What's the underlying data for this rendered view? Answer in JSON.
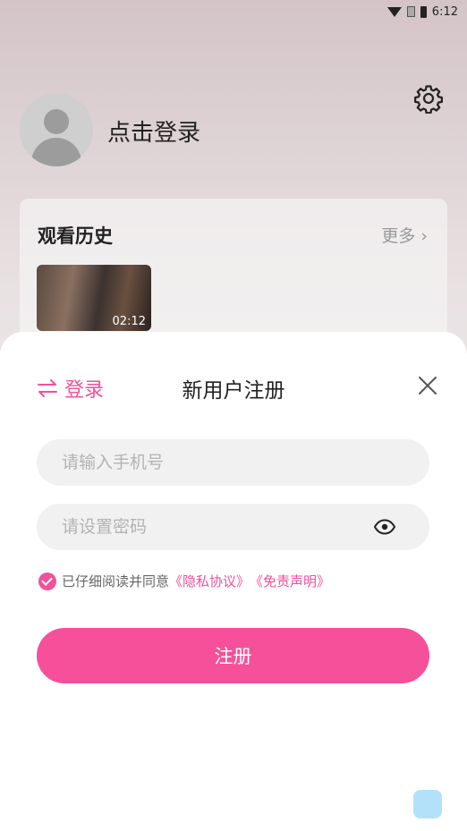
{
  "status_bar": {
    "time": "6:12",
    "icons": [
      "wifi-icon",
      "sim-icon",
      "battery-icon"
    ]
  },
  "profile": {
    "login_prompt": "点击登录",
    "settings_icon": "gear-icon"
  },
  "history": {
    "title": "观看历史",
    "more_label": "更多",
    "items": [
      {
        "duration": "02:12"
      }
    ]
  },
  "register_sheet": {
    "switch_label": "登录",
    "title": "新用户注册",
    "phone_placeholder": "请输入手机号",
    "password_placeholder": "请设置密码",
    "agreement_prefix": "已仔细阅读并同意",
    "privacy_link": "《隐私协议》",
    "disclaimer_link": "《免责声明》",
    "agreement_checked": true,
    "submit_label": "注册"
  },
  "colors": {
    "accent": "#f0519a",
    "button": "#f6509a",
    "input_bg": "#f1f1f1"
  }
}
